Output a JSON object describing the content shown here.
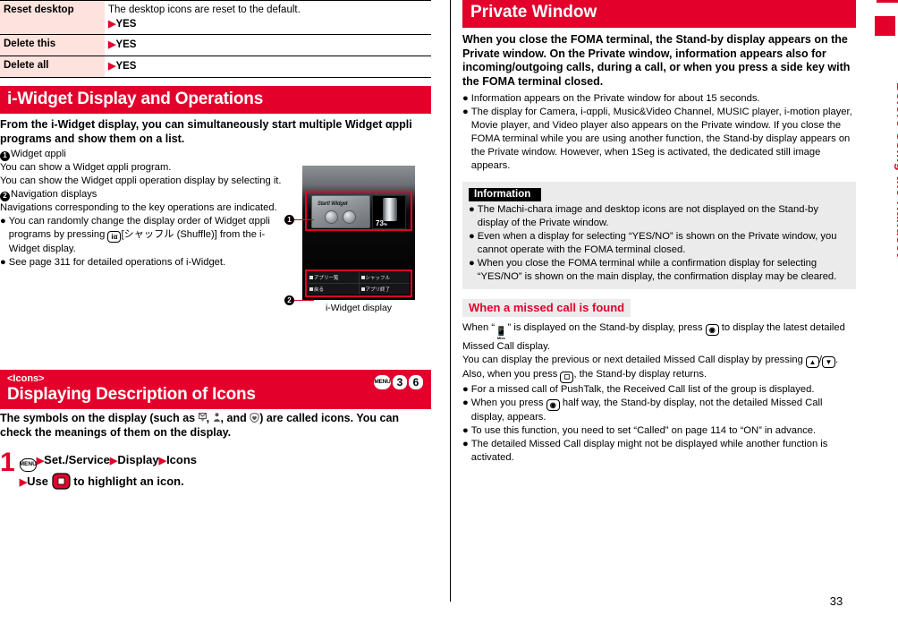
{
  "page": {
    "number": "33",
    "side_tab_label": "Before Using the Handset",
    "accent_color": "#e3002b",
    "table_term_bg": "#fde2dd",
    "info_bg": "#ebebeb"
  },
  "spec_table": {
    "rows": [
      {
        "term": "Reset desktop",
        "desc": "The desktop icons are reset to the default.",
        "yes": "YES"
      },
      {
        "term": "Delete this",
        "desc": "",
        "yes": "YES"
      },
      {
        "term": "Delete all",
        "desc": "",
        "yes": "YES"
      }
    ]
  },
  "section_iwidget": {
    "banner_title": "i-Widget Display and Operations",
    "lead": "From the i-Widget display, you can simultaneously start multiple Widget αppli programs and show them on a list.",
    "item1_label": "Widget αppli",
    "item1_line1": "You can show a Widget αppli program.",
    "item1_line2": "You can show the Widget αppli operation display by selecting it.",
    "item2_label": "Navigation displays",
    "item2_line1": "Navigations corresponding to the key operations are indicated.",
    "bullet1_a": "You can randomly change the display order of Widget αppli programs by pressing ",
    "bullet1_key": "iα",
    "bullet1_b": "[シャッフル (Shuffle)] from the i-Widget display.",
    "bullet2": "See page 311 for detailed operations of i-Widget.",
    "callout1": "1",
    "callout2": "2",
    "figure_caption": "i-Widget display",
    "phone": {
      "widget_label": "Start! Widget",
      "battery_value": "73",
      "battery_unit": "%",
      "nav_items": [
        "アプリ一覧",
        "シャッフル",
        "戻る",
        "アプリ終了"
      ]
    }
  },
  "section_icons": {
    "banner_sub": "<Icons>",
    "banner_title": "Displaying Description of Icons",
    "keys": [
      "MENU",
      "3",
      "6"
    ],
    "intro_a": "The symbols on the display (such as ",
    "intro_icon1": "mail-icon",
    "intro_icon2": "person-icon",
    "intro_icon3": "heart-shield-icon",
    "intro_b": ") are called icons. You can check the meanings of them on the display.",
    "step_number": "1",
    "step_line1_key": "MENU",
    "step_line1_items": [
      "Set./Service",
      "Display",
      "Icons"
    ],
    "step_line2_a": "Use ",
    "step_line2_key": "multi-cursor-key",
    "step_line2_b": " to highlight an icon."
  },
  "section_private": {
    "banner_title": "Private Window",
    "lead": "When you close the FOMA terminal, the Stand-by display appears on the Private window. On the Private window, information appears also for incoming/outgoing calls, during a call, or when you press a side key with the FOMA terminal closed.",
    "bullets": [
      "Information appears on the Private window for about 15 seconds.",
      "The display for Camera, i-αppli, Music&Video Channel, MUSIC player, i-motion player, Movie player, and Video player also appears on the Private window. If you close the FOMA terminal while you are using another function, the Stand-by display appears on the Private window. However, when 1Seg is activated, the dedicated still image appears."
    ],
    "information": {
      "tag": "Information",
      "bullets": [
        "The Machi-chara image and desktop icons are not displayed on the Stand-by display of the Private window.",
        "Even when a display for selecting “YES/NO” is shown on the Private window, you cannot operate with the FOMA terminal closed.",
        "When you close the FOMA terminal while a confirmation display for selecting “YES/NO” is shown on the main display, the confirmation display may be cleared."
      ]
    },
    "missed_call": {
      "heading": "When a missed call is found",
      "intro_a": "When “",
      "intro_icon": "missed-call-icon",
      "intro_icon_label": "Miss",
      "intro_b": "” is displayed on the Stand-by display, press ",
      "intro_key": "camera-key",
      "intro_c": " to display the latest detailed Missed Call display.",
      "line2_a": "You can display the previous or next detailed Missed Call display by pressing ",
      "line2_key1": "▲",
      "line2_key2": "▼",
      "line2_b": ".",
      "line3_a": "Also, when you press ",
      "line3_key": "clear-key",
      "line3_b": ", the Stand-by display returns.",
      "bullets": [
        "For a missed call of PushTalk, the Received Call list of the group is displayed.",
        "When you press {KEY} half way, the Stand-by display, not the detailed Missed Call display, appears.",
        "To use this function, you need to set “Called” on page 114 to “ON” in advance.",
        "The detailed Missed Call display might not be displayed while another function is activated."
      ],
      "bullet2_a": "When you press ",
      "bullet2_key": "camera-key",
      "bullet2_b": " half way, the Stand-by display, not the detailed Missed Call display, appears."
    }
  }
}
